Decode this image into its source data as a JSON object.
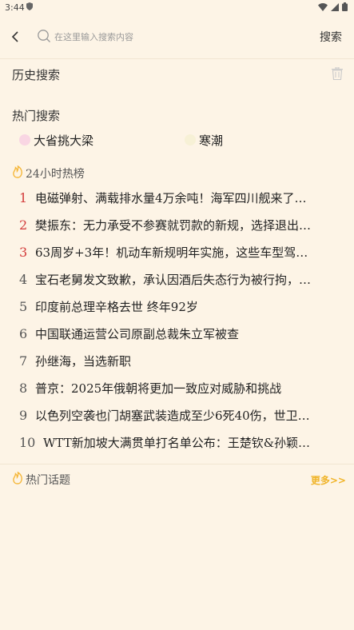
{
  "status_bar": {
    "time": "3:44"
  },
  "search": {
    "placeholder": "在这里输入搜索内容",
    "button_label": "搜索"
  },
  "history": {
    "title": "历史搜索"
  },
  "hot_search": {
    "title": "热门搜索",
    "items": [
      {
        "label": "大省挑大梁",
        "dot_color": "#f9d6e3"
      },
      {
        "label": "寒潮",
        "dot_color": "#f7f1d6"
      }
    ]
  },
  "ranking": {
    "title": "24小时热榜",
    "items": [
      {
        "rank": "1",
        "text": "电磁弹射、满载排水量4万余吨！海军四川舰来了…"
      },
      {
        "rank": "2",
        "text": "樊振东：无力承受不参赛就罚款的新规，选择退出…"
      },
      {
        "rank": "3",
        "text": "63周岁+3年！机动车新规明年实施，这些车型驾…"
      },
      {
        "rank": "4",
        "text": "宝石老舅发文致歉，承认因酒后失态行为被行拘，…"
      },
      {
        "rank": "5",
        "text": "印度前总理辛格去世 终年92岁"
      },
      {
        "rank": "6",
        "text": "中国联通运营公司原副总裁朱立军被查"
      },
      {
        "rank": "7",
        "text": "孙继海，当选新职"
      },
      {
        "rank": "8",
        "text": "普京：2025年俄朝将更加一致应对威胁和挑战"
      },
      {
        "rank": "9",
        "text": "以色列空袭也门胡塞武装造成至少6死40伤，世卫…"
      },
      {
        "rank": "10",
        "text": "WTT新加坡大满贯单打名单公布：王楚钦&孙颖…"
      }
    ]
  },
  "topics": {
    "title": "热门话题",
    "more_label": "更多>>"
  },
  "colors": {
    "background": "#fdf4e6",
    "top_rank": "#d33b3b",
    "more_link": "#f0b429",
    "flame": "#f5b73a"
  }
}
